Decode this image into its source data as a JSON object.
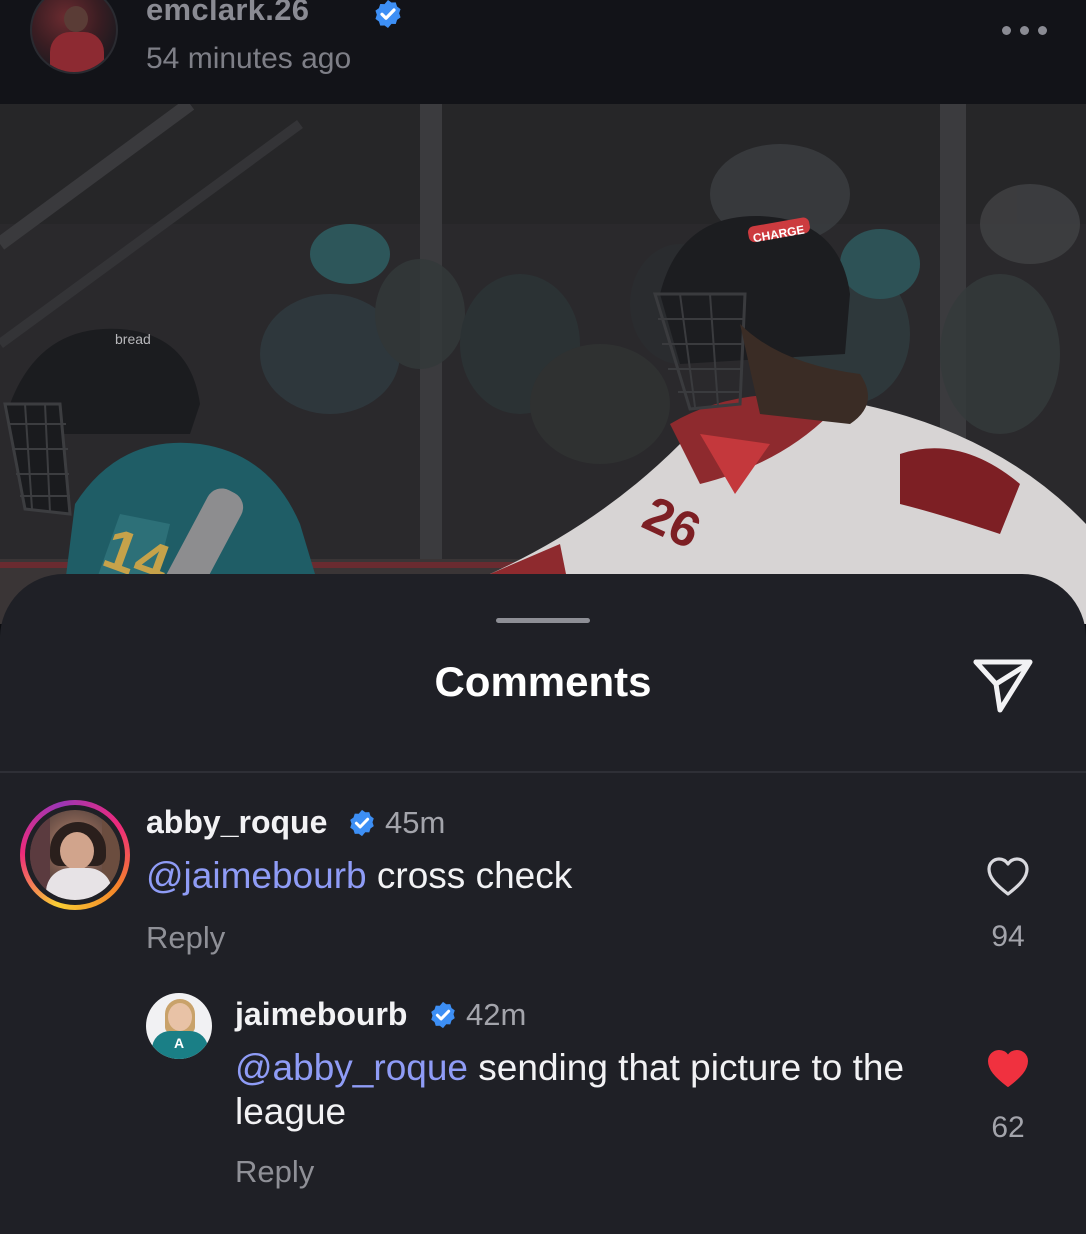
{
  "post": {
    "username": "emclark.26",
    "time": "54 minutes ago",
    "photo_text": {
      "left_number": "14",
      "right_number": "26",
      "helmet_brand": "bread",
      "helmet_sponsor": "CHARGE"
    }
  },
  "comments_sheet": {
    "title": "Comments",
    "comments": [
      {
        "username": "abby_roque",
        "time": "45m",
        "mention": "@jaimebourb",
        "text": " cross check",
        "reply_label": "Reply",
        "likes": "94",
        "liked": false
      },
      {
        "username": "jaimebourb",
        "time": "42m",
        "mention": "@abby_roque",
        "text": " sending that picture to the league",
        "reply_label": "Reply",
        "likes": "62",
        "liked": true,
        "avatar_letter": "A"
      }
    ]
  },
  "colors": {
    "background": "#1f2026",
    "header": "#121318",
    "mention": "#8f9cf6",
    "verified": "#3d8ff5",
    "liked_heart": "#f0313f"
  },
  "icons": [
    "more-icon",
    "verified-icon",
    "share-icon",
    "heart-outline-icon",
    "heart-filled-icon"
  ]
}
